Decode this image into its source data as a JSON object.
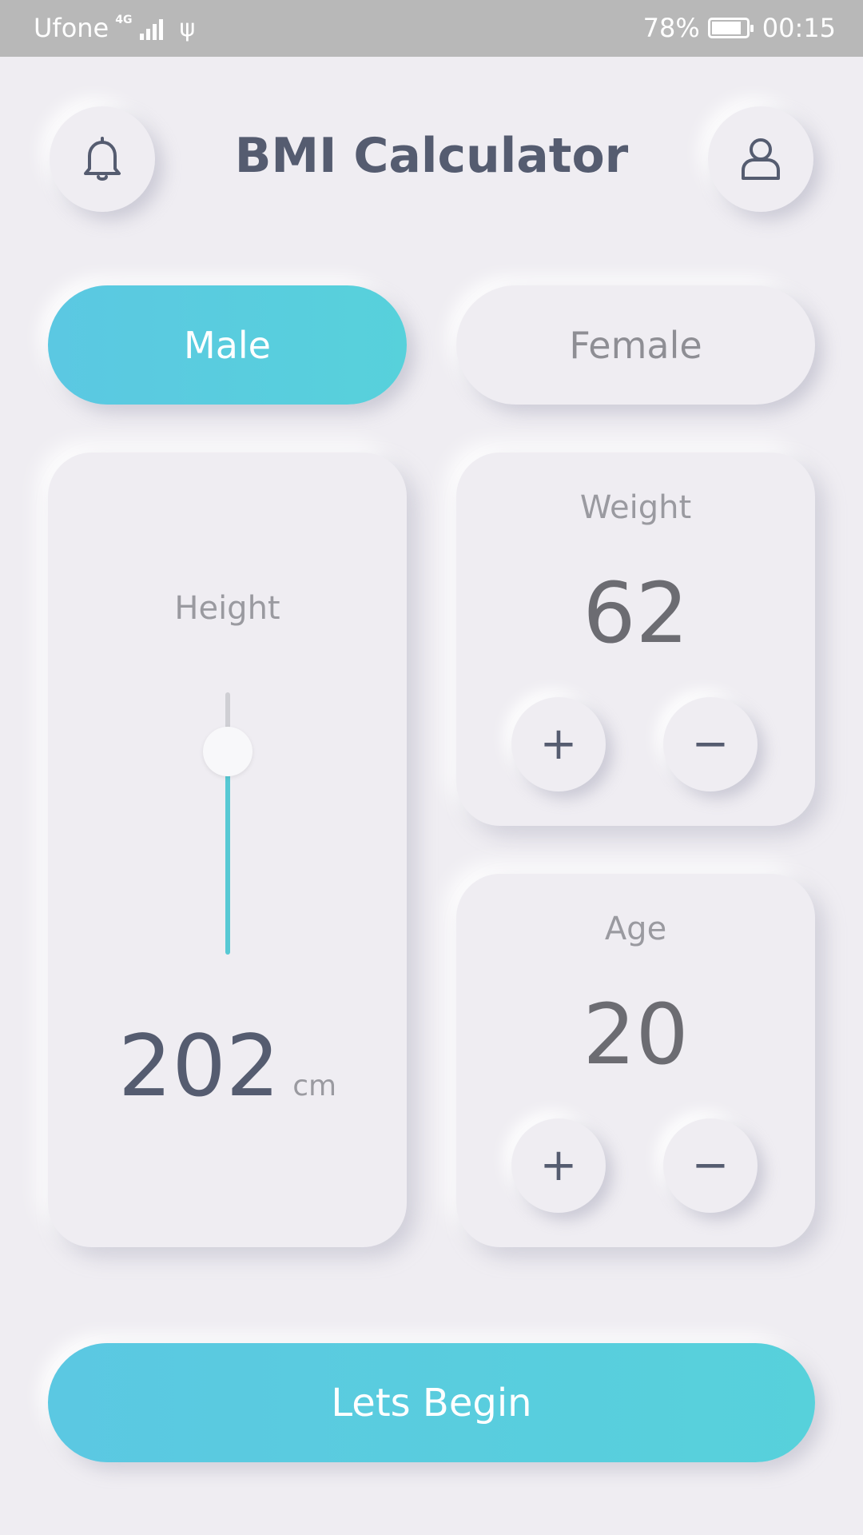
{
  "status_bar": {
    "carrier": "Ufone",
    "network": "4G",
    "battery": "78%",
    "time": "00:15"
  },
  "header": {
    "title": "BMI Calculator",
    "left_icon": "bell-icon",
    "right_icon": "user-icon"
  },
  "gender": {
    "male_label": "Male",
    "female_label": "Female",
    "selected": "Male"
  },
  "height": {
    "label": "Height",
    "value": "202",
    "unit": "cm"
  },
  "weight": {
    "label": "Weight",
    "value": "62",
    "plus": "+",
    "minus": "−"
  },
  "age": {
    "label": "Age",
    "value": "20",
    "plus": "+",
    "minus": "−"
  },
  "action": {
    "begin_label": "Lets Begin"
  },
  "colors": {
    "accent": "#57cbdc",
    "background": "#efedf2",
    "title": "#555c70"
  }
}
